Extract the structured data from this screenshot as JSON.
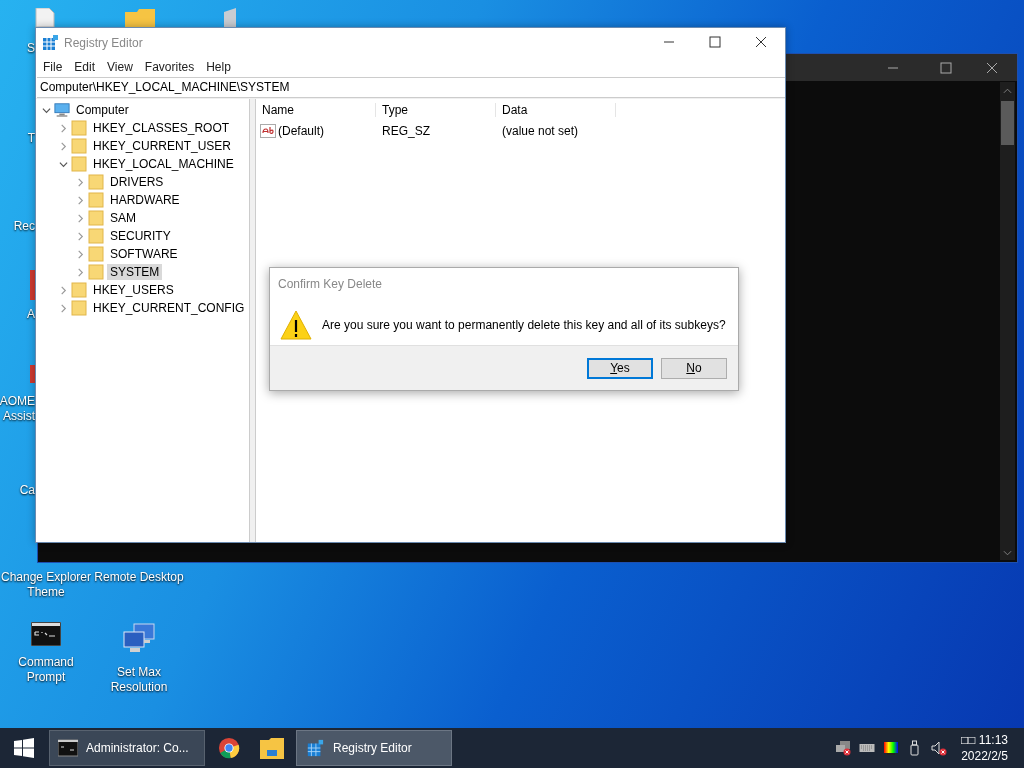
{
  "desktop": {
    "partial_labels": [
      {
        "lines": [
          "S"
        ]
      },
      {
        "lines": [
          "T"
        ]
      },
      {
        "lines": [
          "Rec"
        ]
      },
      {
        "lines": [
          "A"
        ]
      },
      {
        "lines": [
          "AOME",
          "Assist"
        ]
      },
      {
        "lines": [
          "Ca"
        ]
      }
    ],
    "icons": [
      {
        "label": "Change Explorer Theme",
        "kind": "hidden"
      },
      {
        "label": "Remote Desktop",
        "kind": "hidden"
      },
      {
        "label": "Command Prompt",
        "kind": "console"
      },
      {
        "label": "Set Max Resolution",
        "kind": "monitors"
      }
    ]
  },
  "registry_editor": {
    "title": "Registry Editor",
    "menu": [
      "File",
      "Edit",
      "View",
      "Favorites",
      "Help"
    ],
    "address": "Computer\\HKEY_LOCAL_MACHINE\\SYSTEM",
    "tree": [
      {
        "label": "Computer",
        "kind": "computer",
        "expanded": true,
        "selected": false,
        "children": [
          {
            "label": "HKEY_CLASSES_ROOT",
            "kind": "folder",
            "expanded": false,
            "selected": false
          },
          {
            "label": "HKEY_CURRENT_USER",
            "kind": "folder",
            "expanded": false,
            "selected": false
          },
          {
            "label": "HKEY_LOCAL_MACHINE",
            "kind": "folder",
            "expanded": true,
            "selected": false,
            "children": [
              {
                "label": "DRIVERS",
                "kind": "folder",
                "expanded": false,
                "selected": false
              },
              {
                "label": "HARDWARE",
                "kind": "folder",
                "expanded": false,
                "selected": false
              },
              {
                "label": "SAM",
                "kind": "folder",
                "expanded": false,
                "selected": false
              },
              {
                "label": "SECURITY",
                "kind": "folder",
                "expanded": false,
                "selected": false
              },
              {
                "label": "SOFTWARE",
                "kind": "folder",
                "expanded": false,
                "selected": false
              },
              {
                "label": "SYSTEM",
                "kind": "folder",
                "expanded": false,
                "selected": true
              }
            ]
          },
          {
            "label": "HKEY_USERS",
            "kind": "folder",
            "expanded": false,
            "selected": false
          },
          {
            "label": "HKEY_CURRENT_CONFIG",
            "kind": "folder",
            "expanded": false,
            "selected": false
          }
        ]
      }
    ],
    "columns": [
      "Name",
      "Type",
      "Data"
    ],
    "values": [
      {
        "name": "(Default)",
        "type": "REG_SZ",
        "data": "(value not set)"
      }
    ]
  },
  "dialog": {
    "title": "Confirm Key Delete",
    "message": "Are you sure you want to permanently delete this key and all of its subkeys?",
    "buttons": [
      {
        "label": "Yes",
        "default": true
      },
      {
        "label": "No",
        "default": false
      }
    ]
  },
  "taskbar": {
    "items": [
      {
        "kind": "console",
        "label": "Administrator: Co...",
        "selected": false
      },
      {
        "kind": "browser",
        "selected": false
      },
      {
        "kind": "folder",
        "selected": false
      },
      {
        "kind": "registry",
        "label": "Registry Editor",
        "selected": true
      }
    ],
    "clock": {
      "time": "□□ 11:13",
      "date": "2022/2/5"
    }
  }
}
